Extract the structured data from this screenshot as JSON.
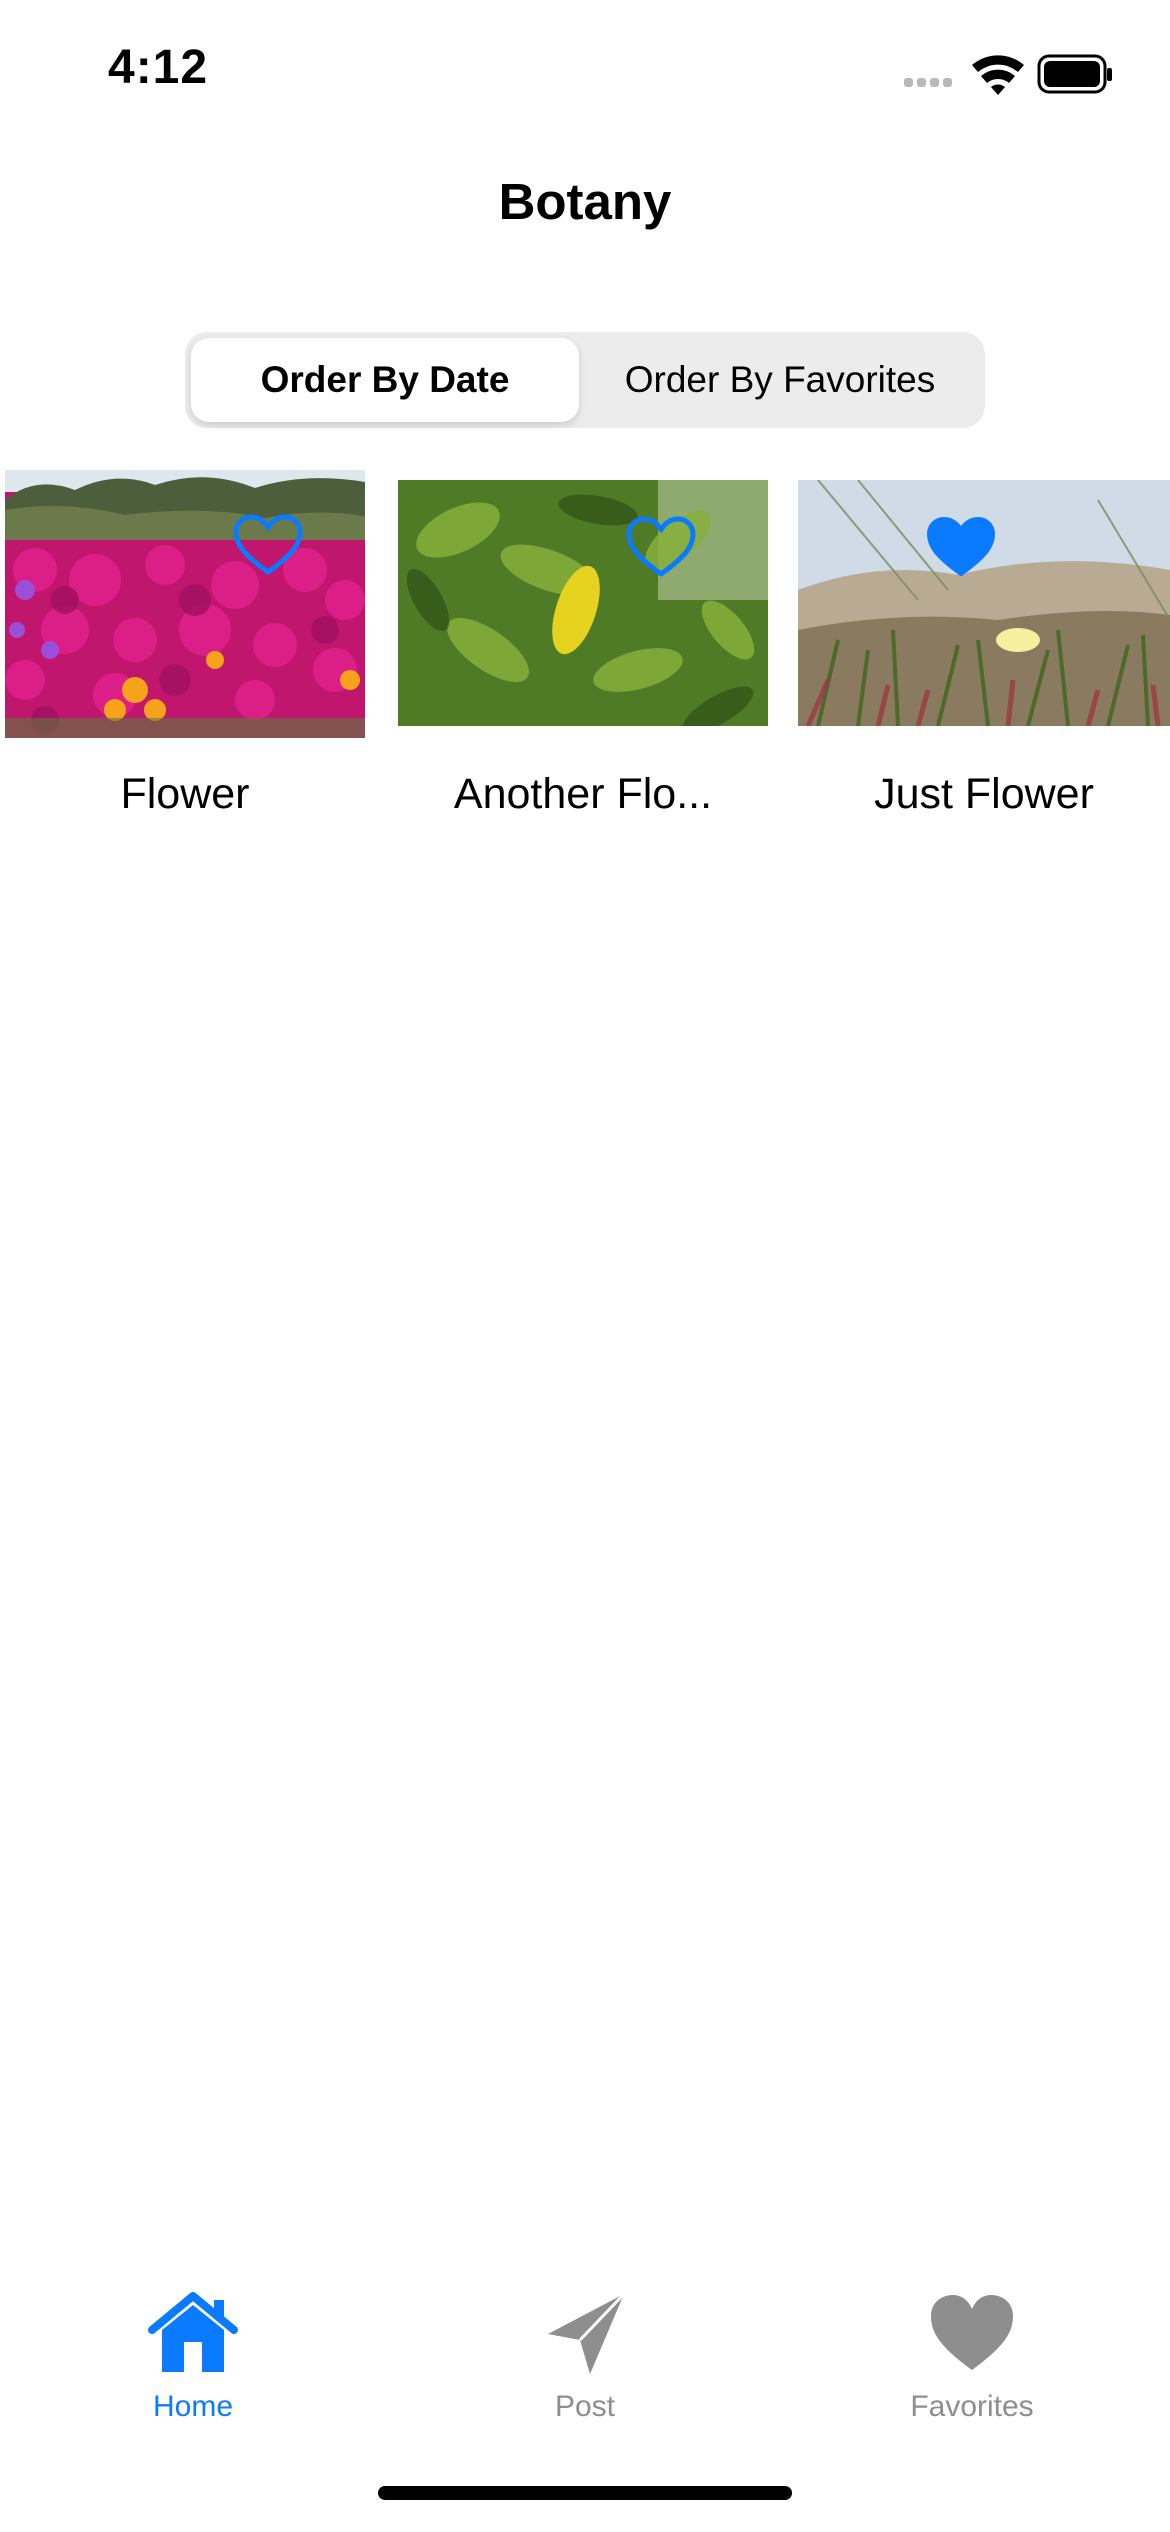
{
  "status_bar": {
    "time": "4:12",
    "icons": [
      "cellular-signal-icon",
      "wifi-icon",
      "battery-icon"
    ]
  },
  "nav": {
    "title": "Botany"
  },
  "segmented_control": {
    "options": [
      "Order By Date",
      "Order By Favorites"
    ],
    "selected": "Order By Date"
  },
  "photos": [
    {
      "title": "Flower",
      "favorite": false,
      "image": "magenta-flower-field-photo"
    },
    {
      "title": "Another Flo...",
      "favorite": false,
      "image": "green-leaves-photo"
    },
    {
      "title": "Just Flower",
      "favorite": true,
      "image": "dune-succulent-flower-photo"
    }
  ],
  "tab_bar": {
    "tabs": [
      {
        "label": "Home",
        "icon": "house-icon",
        "active": true
      },
      {
        "label": "Post",
        "icon": "paper-plane-icon",
        "active": false
      },
      {
        "label": "Favorites",
        "icon": "heart-icon",
        "active": false
      }
    ]
  },
  "colors": {
    "accent": "#0a7aff",
    "inactive_tab": "#8e8e8e",
    "segment_background": "#ececec"
  }
}
